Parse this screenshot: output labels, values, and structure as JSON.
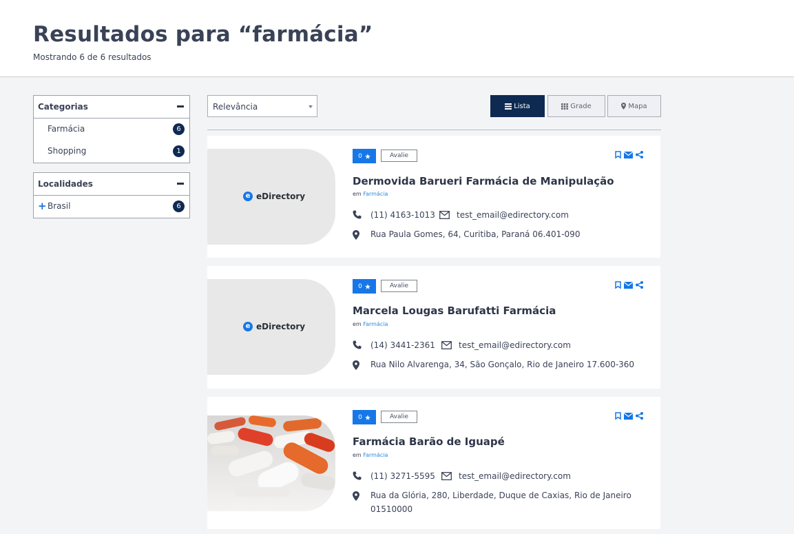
{
  "header": {
    "title": "Resultados para “farmácia”",
    "subtitle": "Mostrando 6 de 6 resultados"
  },
  "filters": {
    "categories": {
      "title": "Categorias",
      "items": [
        {
          "label": "Farmácia",
          "count": "6"
        },
        {
          "label": "Shopping",
          "count": "1"
        }
      ]
    },
    "locations": {
      "title": "Localidades",
      "items": [
        {
          "label": "Brasil",
          "count": "6"
        }
      ]
    }
  },
  "toolbar": {
    "sort_value": "Relevância",
    "views": [
      {
        "label": "Lista",
        "icon": "list-icon",
        "active": true
      },
      {
        "label": "Grade",
        "icon": "grid-icon",
        "active": false
      },
      {
        "label": "Mapa",
        "icon": "map-marker-icon",
        "active": false
      }
    ]
  },
  "results": [
    {
      "logo_text": "eDirectory",
      "logo_letter": "e",
      "rating": "0",
      "review_label": "Avalie",
      "title": "Dermovida Barueri Farmácia de Manipulação",
      "category_prefix": "em",
      "category": "Farmácia",
      "phone": "(11) 4163-1013",
      "email": "test_email@edirectory.com",
      "address": "Rua Paula Gomes, 64, Curitiba, Paraná 06.401-090"
    },
    {
      "logo_text": "eDirectory",
      "logo_letter": "e",
      "rating": "0",
      "review_label": "Avalie",
      "title": "Marcela Lougas Barufatti Farmácia",
      "category_prefix": "em",
      "category": "Farmácia",
      "phone": "(14) 3441-2361",
      "email": "test_email@edirectory.com",
      "address": "Rua Nilo Alvarenga, 34, São Gonçalo, Rio de Janeiro 17.600-360"
    },
    {
      "rating": "0",
      "review_label": "Avalie",
      "title": "Farmácia Barão de Iguapé",
      "category_prefix": "em",
      "category": "Farmácia",
      "phone": "(11) 3271-5595",
      "email": "test_email@edirectory.com",
      "address": "Rua da Glória, 280, Liberdade, Duque de Caxias, Rio de Janeiro 01510000"
    }
  ],
  "colors": {
    "accent": "#1677e8",
    "navy": "#0f2a52",
    "text": "#3a4256",
    "link": "#2a8ae0"
  }
}
